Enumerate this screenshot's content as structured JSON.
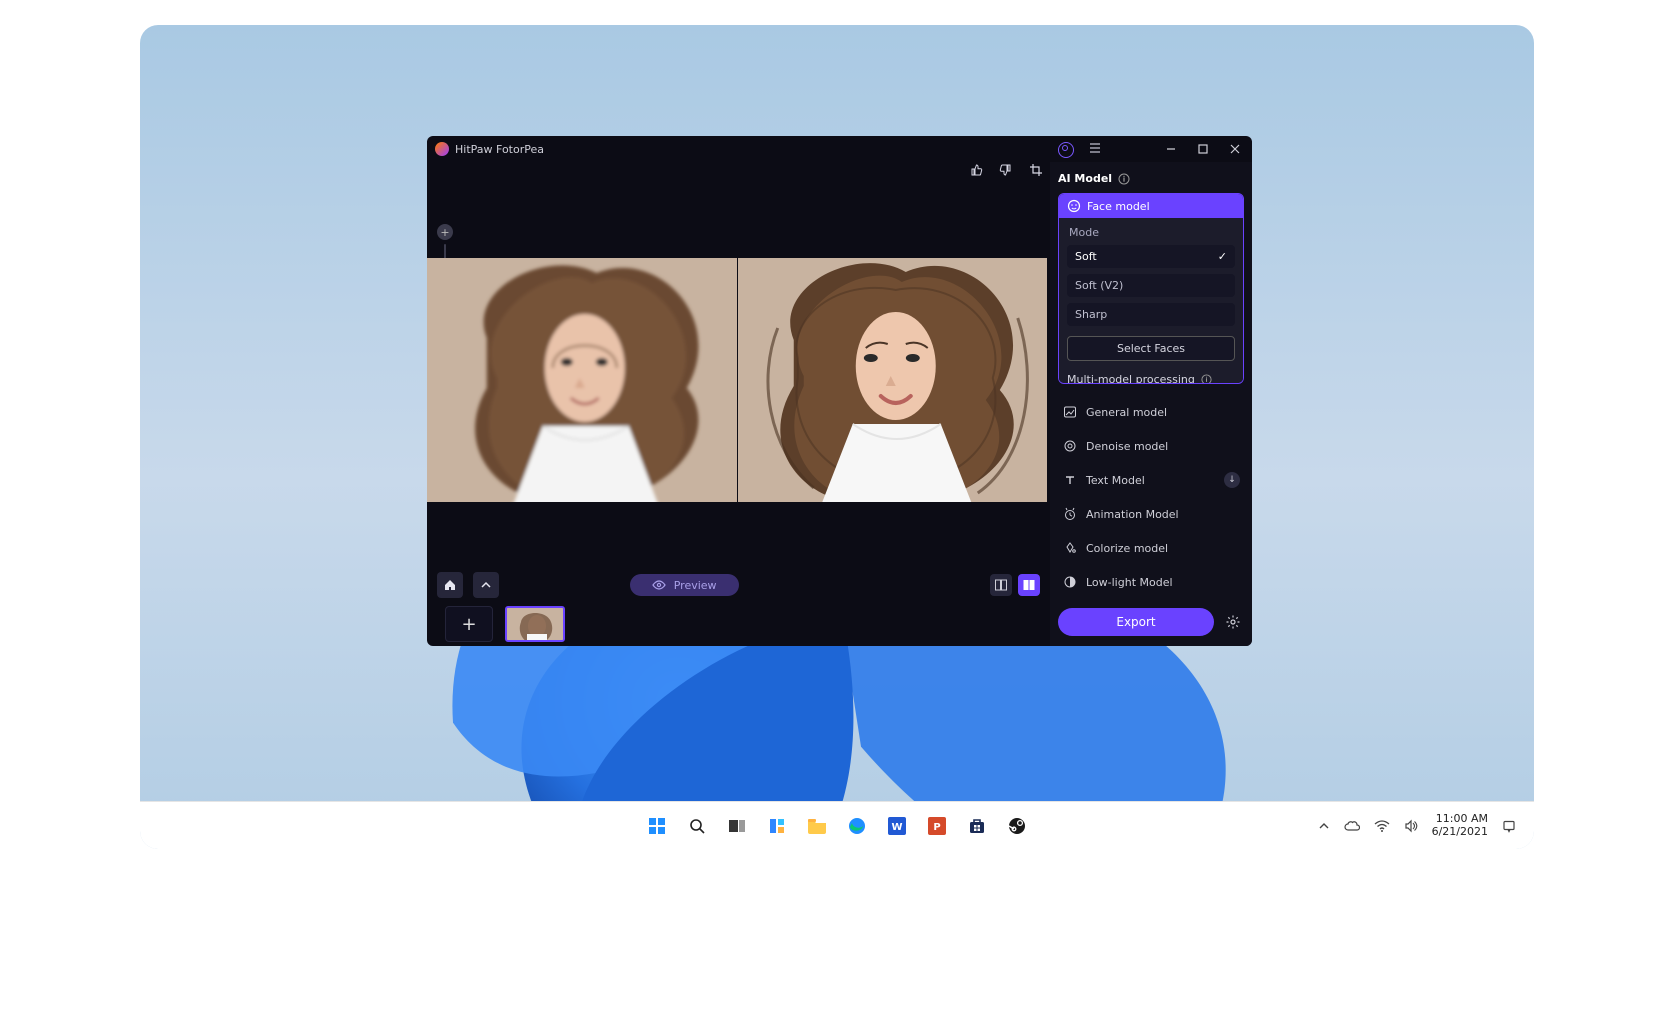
{
  "app": {
    "title": "HitPaw FotorPea"
  },
  "panel": {
    "title": "AI Model",
    "face": {
      "head": "Face model",
      "mode_label": "Mode",
      "options": [
        {
          "label": "Soft",
          "selected": true
        },
        {
          "label": "Soft (V2)",
          "selected": false
        },
        {
          "label": "Sharp",
          "selected": false
        }
      ],
      "select_faces": "Select Faces",
      "multi_label": "Multi-model processing",
      "colorize_label": "Colorize model"
    },
    "models": [
      {
        "label": "General model"
      },
      {
        "label": "Denoise model"
      },
      {
        "label": "Text Model",
        "download": true
      },
      {
        "label": "Animation Model"
      },
      {
        "label": "Colorize model"
      },
      {
        "label": "Low-light Model"
      }
    ],
    "export_label": "Export"
  },
  "preview_label": "Preview",
  "taskbar": {
    "time": "11:00 AM",
    "date": "6/21/2021"
  }
}
